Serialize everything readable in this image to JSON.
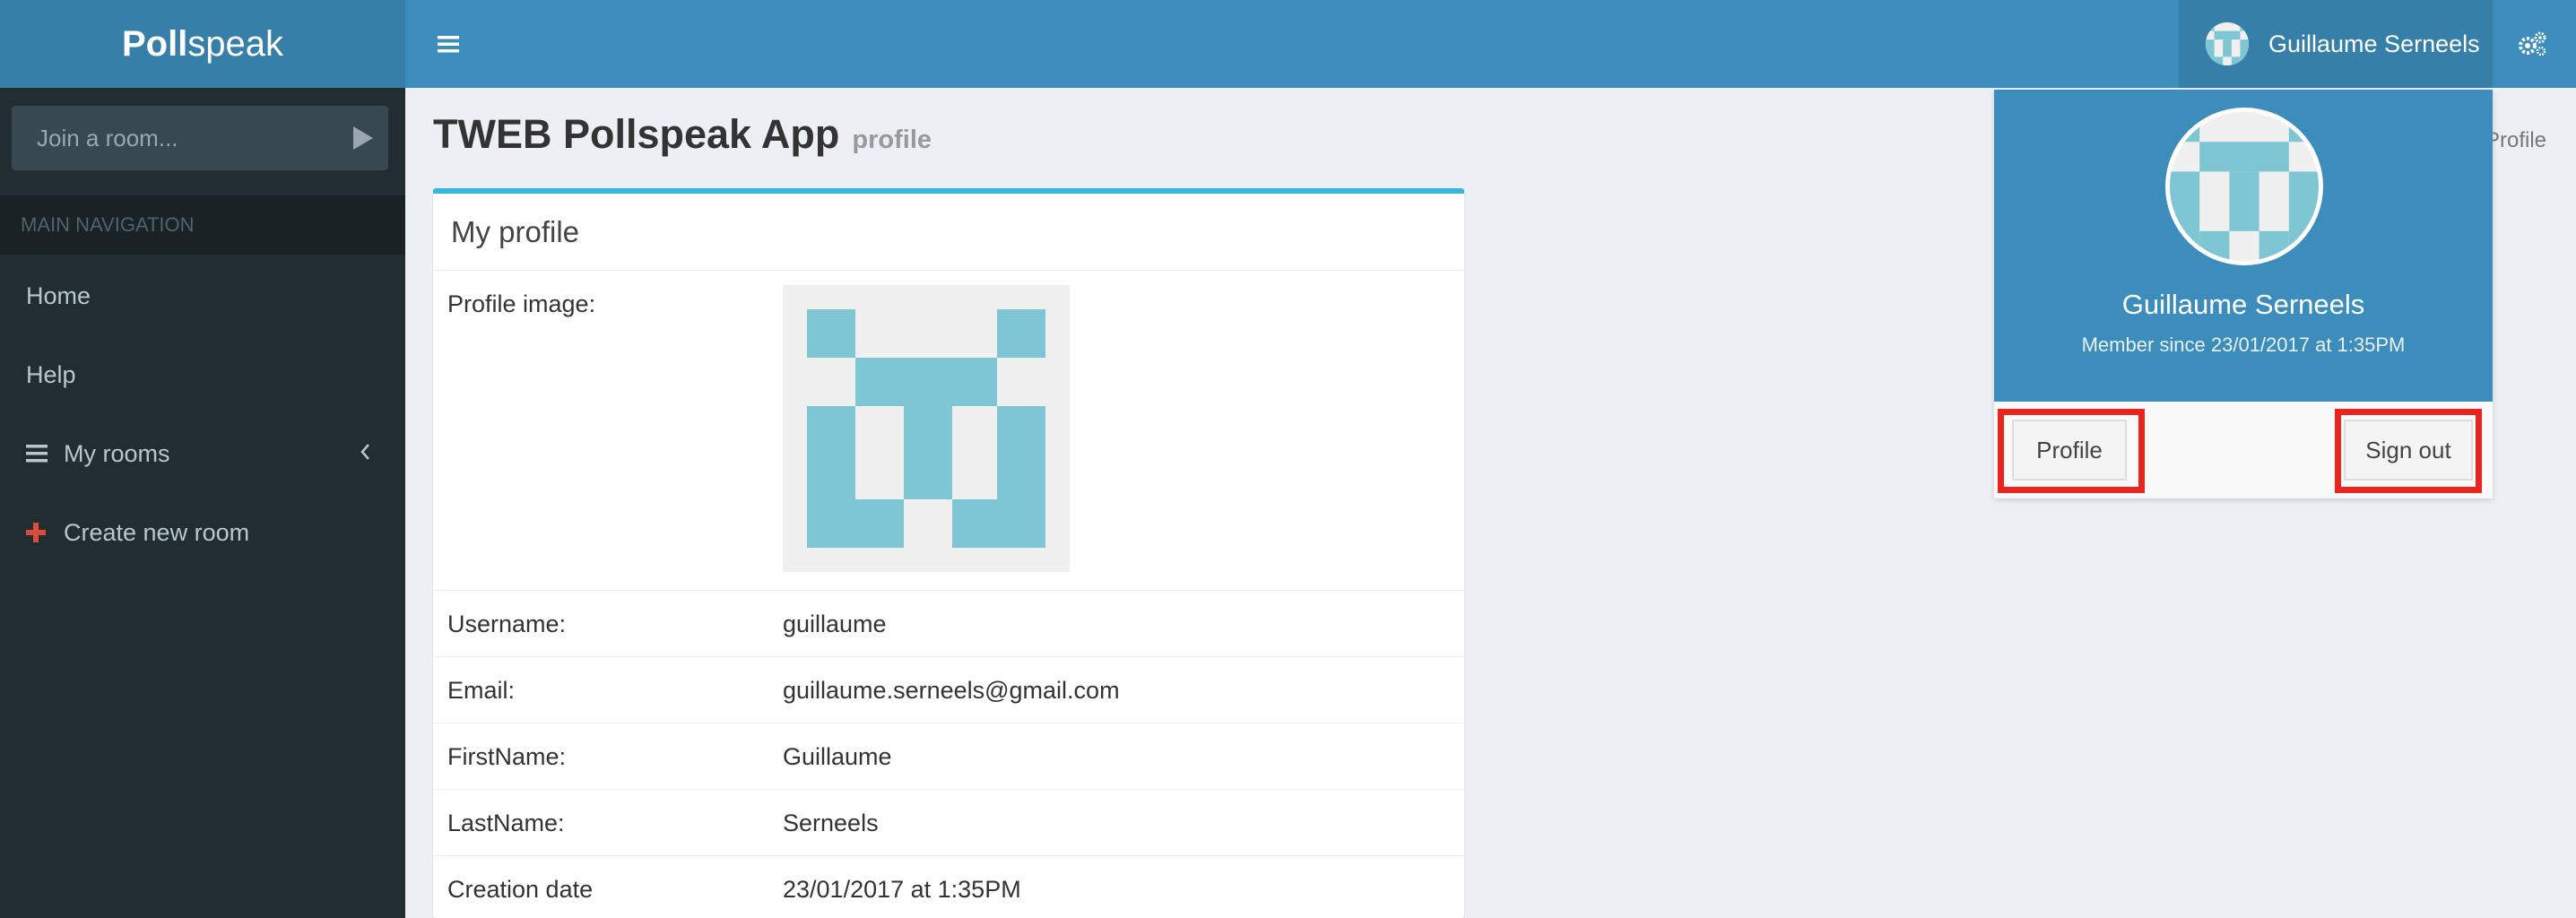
{
  "brand": {
    "bold": "Poll",
    "light": "speak"
  },
  "sidebar": {
    "room_placeholder": "Join a room...",
    "nav_header": "MAIN NAVIGATION",
    "items": [
      {
        "label": "Home"
      },
      {
        "label": "Help"
      },
      {
        "label": "My rooms"
      },
      {
        "label": "Create new room"
      }
    ]
  },
  "header": {
    "user_name": "Guillaume Serneels"
  },
  "page": {
    "title": "TWEB Pollspeak App",
    "subtitle": "profile",
    "breadcrumb": "Profile"
  },
  "profile": {
    "box_title": "My profile",
    "rows": [
      {
        "label": "Profile image:"
      },
      {
        "label": "Username:",
        "value": "guillaume"
      },
      {
        "label": "Email:",
        "value": "guillaume.serneels@gmail.com"
      },
      {
        "label": "FirstName:",
        "value": "Guillaume"
      },
      {
        "label": "LastName:",
        "value": "Serneels"
      },
      {
        "label": "Creation date",
        "value": "23/01/2017 at 1:35PM"
      }
    ]
  },
  "dropdown": {
    "name": "Guillaume Serneels",
    "member_since": "Member since 23/01/2017 at 1:35PM",
    "profile_btn": "Profile",
    "signout_btn": "Sign out"
  },
  "colors": {
    "primary": "#3c8dbc",
    "primary_dark": "#367fa9",
    "sidebar": "#222d32",
    "identicon": "#7ec6d3",
    "highlight": "#e8251f"
  }
}
